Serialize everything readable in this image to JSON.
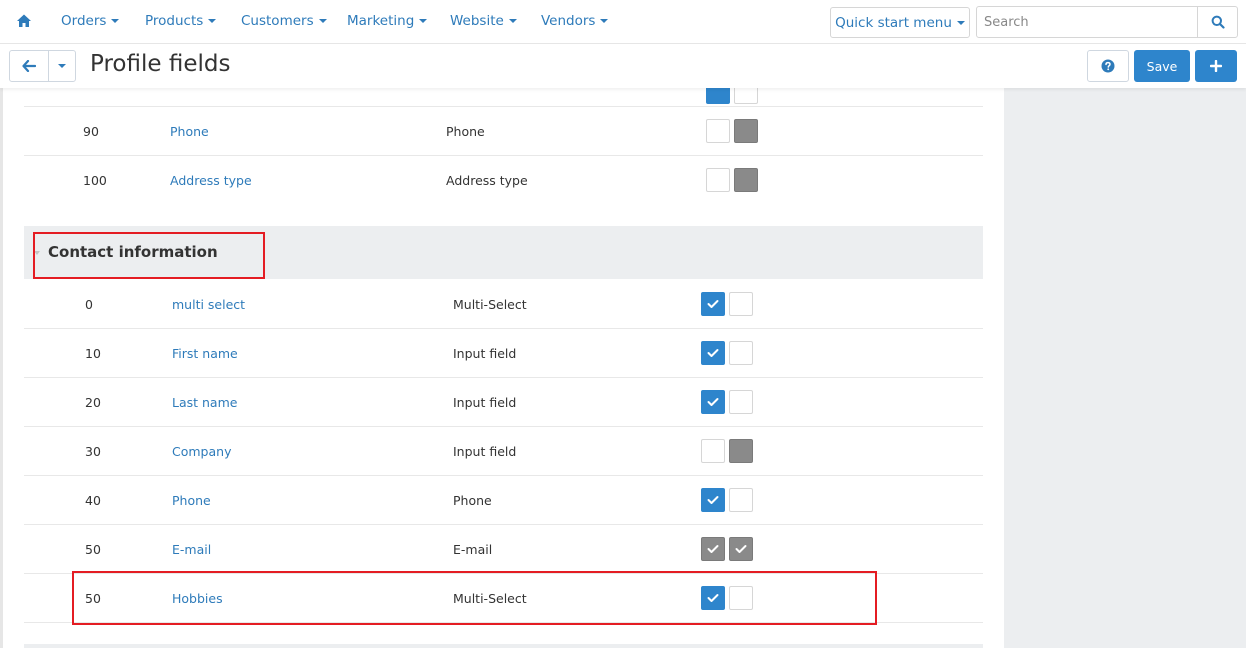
{
  "nav": {
    "items": [
      "Orders",
      "Products",
      "Customers",
      "Marketing",
      "Website",
      "Vendors"
    ],
    "quick_start": "Quick start menu",
    "search_placeholder": "Search"
  },
  "title_bar": {
    "title": "Profile fields",
    "save_label": "Save"
  },
  "top_rows": [
    {
      "position": "90",
      "name": "Phone",
      "type": "Phone",
      "checks": [
        "white",
        "gray"
      ]
    },
    {
      "position": "100",
      "name": "Address type",
      "type": "Address type",
      "checks": [
        "white",
        "gray"
      ]
    }
  ],
  "section": {
    "title": "Contact information",
    "rows": [
      {
        "position": "0",
        "name": "multi select",
        "type": "Multi-Select",
        "checks": [
          "blue",
          "white"
        ]
      },
      {
        "position": "10",
        "name": "First name",
        "type": "Input field",
        "checks": [
          "blue",
          "white"
        ]
      },
      {
        "position": "20",
        "name": "Last name",
        "type": "Input field",
        "checks": [
          "blue",
          "white"
        ]
      },
      {
        "position": "30",
        "name": "Company",
        "type": "Input field",
        "checks": [
          "white",
          "gray"
        ]
      },
      {
        "position": "40",
        "name": "Phone",
        "type": "Phone",
        "checks": [
          "blue",
          "white"
        ]
      },
      {
        "position": "50",
        "name": "E-mail",
        "type": "E-mail",
        "checks": [
          "gray-check",
          "gray-check"
        ]
      },
      {
        "position": "50",
        "name": "Hobbies",
        "type": "Multi-Select",
        "checks": [
          "blue",
          "white"
        ]
      }
    ]
  },
  "colors": {
    "accent": "#2e85cc",
    "link": "#2e7bba",
    "highlight": "#e41c23",
    "disabled": "#8a8a8a"
  },
  "icons": {
    "home": "home-icon",
    "search": "search-icon",
    "back": "arrow-left-icon",
    "help": "question-circle-icon",
    "add": "plus-icon",
    "check": "check-icon"
  }
}
